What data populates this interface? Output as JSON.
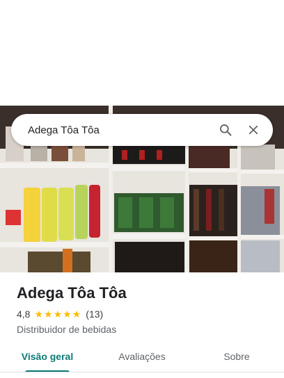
{
  "search": {
    "query": "Adega Tôa Tôa",
    "icons": [
      "search-icon",
      "close-icon"
    ]
  },
  "place": {
    "name": "Adega Tôa Tôa",
    "rating": "4,8",
    "stars": 5,
    "review_count": "(13)",
    "category": "Distribuidor de bebidas"
  },
  "tabs": [
    {
      "label": "Visão geral",
      "active": true
    },
    {
      "label": "Avaliações",
      "active": false
    },
    {
      "label": "Sobre",
      "active": false
    }
  ],
  "colors": {
    "accent": "#0b7a75",
    "star": "#fbbc04",
    "text": "#202124"
  }
}
